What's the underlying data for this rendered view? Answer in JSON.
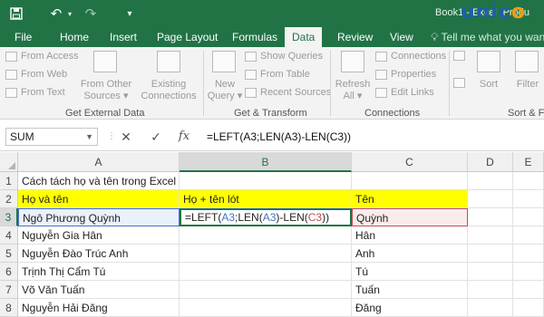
{
  "titlebar": {
    "save_icon": "save-icon",
    "undo_icon": "undo-icon",
    "redo_icon": "redo-icon",
    "title": "Book1 - Excel (Produ",
    "brand_prefix": "unic",
    "brand_o": "o",
    "brand_color": "#1a5faf",
    "accent": "#217346"
  },
  "tabs": [
    {
      "label": "File"
    },
    {
      "label": "Home"
    },
    {
      "label": "Insert"
    },
    {
      "label": "Page Layout"
    },
    {
      "label": "Formulas"
    },
    {
      "label": "Data"
    },
    {
      "label": "Review"
    },
    {
      "label": "View"
    }
  ],
  "tell_me": "Tell me what you want",
  "ribbon": {
    "get_external": {
      "items": [
        "From Access",
        "From Web",
        "From Text"
      ],
      "from_other": [
        "From Other",
        "Sources"
      ],
      "existing": [
        "Existing",
        "Connections"
      ],
      "label": "Get External Data"
    },
    "get_transform": {
      "new_query": [
        "New",
        "Query"
      ],
      "items": [
        "Show Queries",
        "From Table",
        "Recent Sources"
      ],
      "label": "Get & Transform"
    },
    "connections": {
      "refresh": [
        "Refresh",
        "All"
      ],
      "items": [
        "Connections",
        "Properties",
        "Edit Links"
      ],
      "label": "Connections"
    },
    "sort_filter": {
      "sort": "Sort",
      "filter": "Filter",
      "label": "Sort & Fi"
    }
  },
  "formula_bar": {
    "name_box": "SUM",
    "cancel": "✕",
    "enter": "✓",
    "fx": "fx",
    "formula": "=LEFT(A3;LEN(A3)-LEN(C3))"
  },
  "columns": [
    "A",
    "B",
    "C",
    "D",
    "E"
  ],
  "rows": [
    "1",
    "2",
    "3",
    "4",
    "5",
    "6",
    "7",
    "8"
  ],
  "cells": {
    "A1": "Cách tách họ và tên trong Excel",
    "A2": "Họ và tên",
    "B2": "Họ + tên lót",
    "C2": "Tên",
    "A3": "Ngô Phương Quỳnh",
    "B3_parts": [
      "=LEFT(",
      "A3",
      ";LEN(",
      "A3",
      ")-LEN(",
      "C3",
      "))"
    ],
    "C3": "Quỳnh",
    "A4": "Nguyễn Gia Hân",
    "C4": "Hân",
    "A5": "Nguyễn Đào Trúc Anh",
    "C5": "Anh",
    "A6": "Trịnh Thị Cẩm Tú",
    "C6": "Tú",
    "A7": "Võ Văn Tuấn",
    "C7": "Tuấn",
    "A8": "Nguyễn Hải Đăng",
    "C8": "Đăng"
  }
}
